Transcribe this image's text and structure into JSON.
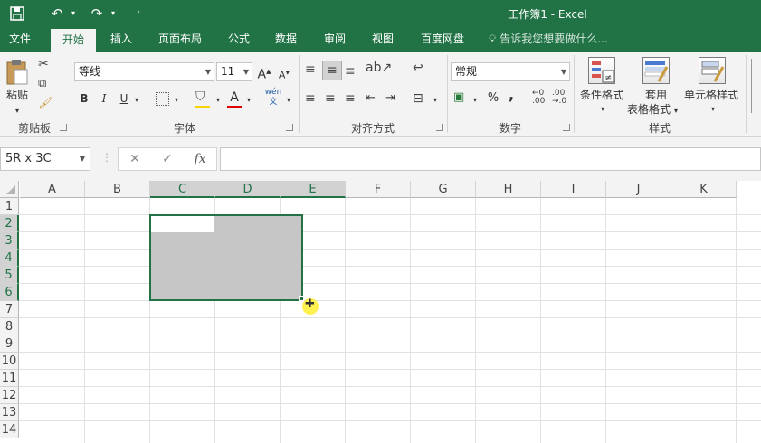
{
  "titlebar": {
    "doc_title": "工作簿1 - Excel",
    "save_icon": "save-icon",
    "undo_icon": "undo-icon",
    "redo_icon": "redo-icon",
    "customize_icon": "customize-qat-icon"
  },
  "tabs": [
    {
      "label": "文件"
    },
    {
      "label": "开始"
    },
    {
      "label": "插入"
    },
    {
      "label": "页面布局"
    },
    {
      "label": "公式"
    },
    {
      "label": "数据"
    },
    {
      "label": "审阅"
    },
    {
      "label": "视图"
    },
    {
      "label": "百度网盘"
    }
  ],
  "tellme": "告诉我您想要做什么...",
  "ribbon": {
    "clipboard": {
      "label": "剪贴板",
      "paste": "粘贴"
    },
    "font": {
      "label": "字体",
      "name": "等线",
      "size": "11",
      "bold": "B",
      "italic": "I",
      "underline": "U",
      "grow": "A",
      "shrink": "A",
      "font_color": "A",
      "phonetic": "wén 文"
    },
    "alignment": {
      "label": "对齐方式"
    },
    "number": {
      "label": "数字",
      "format": "常规",
      "percent": "%",
      "comma": ","
    },
    "styles": {
      "label": "样式",
      "conditional": "条件格式",
      "table_line1": "套用",
      "table_line2": "表格格式",
      "cell_styles": "单元格样式"
    }
  },
  "formula_bar": {
    "namebox": "5R x 3C",
    "cancel": "✕",
    "enter": "✓",
    "fx": "fx",
    "value": ""
  },
  "grid": {
    "columns": [
      "A",
      "B",
      "C",
      "D",
      "E",
      "F",
      "G",
      "H",
      "I",
      "J",
      "K"
    ],
    "selected_columns": [
      "C",
      "D",
      "E"
    ],
    "rows": [
      "1",
      "2",
      "3",
      "4",
      "5",
      "6",
      "7",
      "8",
      "9",
      "10",
      "11",
      "12",
      "13",
      "14"
    ],
    "selected_rows": [
      "2",
      "3",
      "4",
      "5",
      "6"
    ]
  },
  "colors": {
    "accent": "#217346",
    "selection": "#c6c6c6"
  }
}
